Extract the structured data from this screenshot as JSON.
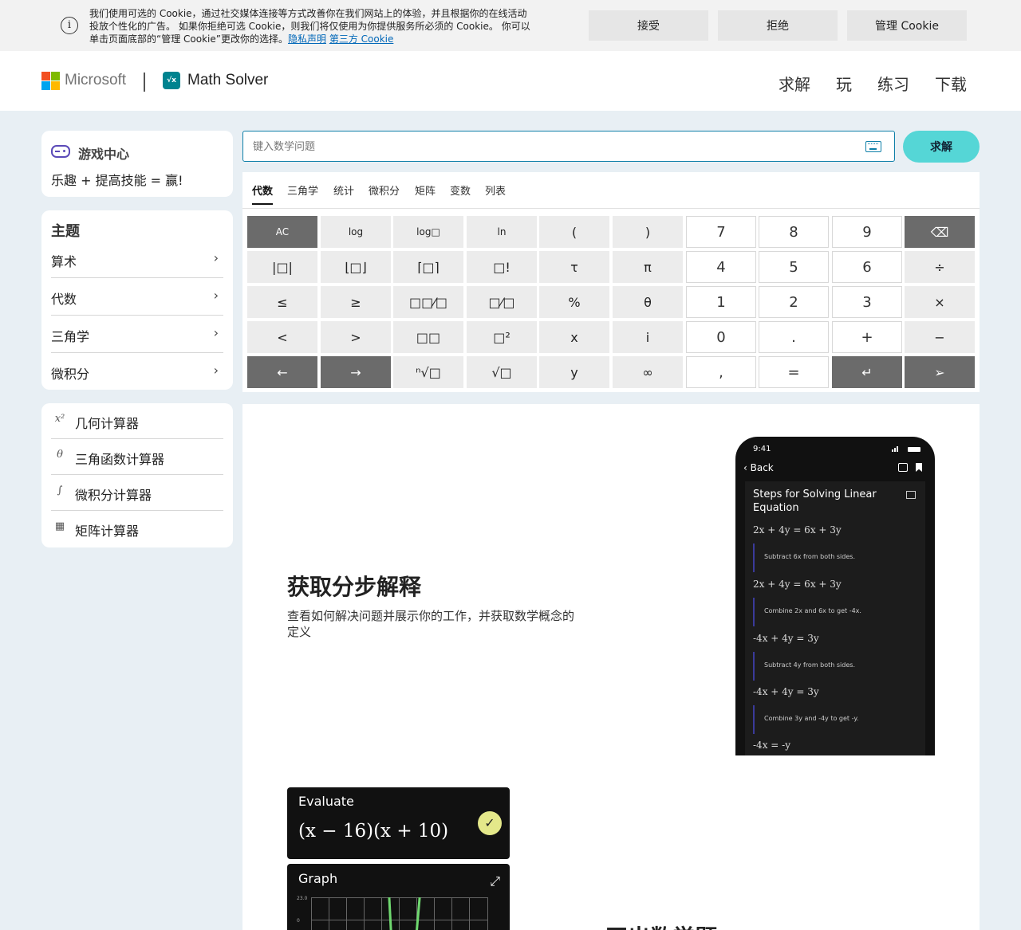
{
  "cookie": {
    "text": "我们使用可选的 Cookie，通过社交媒体连接等方式改善你在我们网站上的体验，并且根据你的在线活动投放个性化的广告。 如果你拒绝可选 Cookie，则我们将仅使用为你提供服务所必须的 Cookie。 你可以单击页面底部的“管理 Cookie”更改你的选择。",
    "privacy_link": "隐私声明",
    "third_party_link": "第三方 Cookie",
    "accept": "接受",
    "reject": "拒绝",
    "manage": "管理 Cookie"
  },
  "header": {
    "brand": "Microsoft",
    "app_name": "Math Solver",
    "app_icon_text": "√x",
    "nav": [
      "求解",
      "玩",
      "练习",
      "下载"
    ]
  },
  "sidebar": {
    "game": {
      "title": "游戏中心",
      "subtitle": "乐趣 + 提高技能 = 赢!"
    },
    "topics": {
      "title": "主题",
      "items": [
        "算术",
        "代数",
        "三角学",
        "微积分"
      ]
    },
    "calculators": [
      {
        "icon": "x²",
        "label": "几何计算器"
      },
      {
        "icon": "θ",
        "label": "三角函数计算器"
      },
      {
        "icon": "∫",
        "label": "微积分计算器"
      },
      {
        "icon": "▦",
        "label": "矩阵计算器"
      }
    ]
  },
  "search": {
    "placeholder": "键入数学问题",
    "solve": "求解"
  },
  "keypad": {
    "tabs": [
      "代数",
      "三角学",
      "统计",
      "微积分",
      "矩阵",
      "变数",
      "列表"
    ],
    "rows": [
      [
        "AC",
        "log",
        "log□",
        "ln",
        "(",
        ")",
        "7",
        "8",
        "9",
        "⌫"
      ],
      [
        "|□|",
        "⌊□⌋",
        "⌈□⌉",
        "□!",
        "τ",
        "π",
        "4",
        "5",
        "6",
        "÷"
      ],
      [
        "≤",
        "≥",
        "□□⁄□",
        "□⁄□",
        "%",
        "θ",
        "1",
        "2",
        "3",
        "×"
      ],
      [
        "<",
        ">",
        "□□",
        "□²",
        "x",
        "i",
        "0",
        ".",
        "+",
        "−"
      ],
      [
        "←",
        "→",
        "ⁿ√□",
        "√□",
        "y",
        "∞",
        ",",
        "=",
        "↵",
        "➢"
      ]
    ]
  },
  "feature": {
    "title": "获取分步解释",
    "description": "查看如何解决问题并展示你的工作，并获取数学概念的定义",
    "title2": "画出数学题"
  },
  "phone": {
    "time": "9:41",
    "back": "Back",
    "title": "Steps for Solving Linear Equation",
    "equations": [
      "2x + 4y = 6x + 3y",
      "2x + 4y = 6x + 3y",
      "-4x + 4y = 3y",
      "-4x + 4y = 3y",
      "-4x = -y"
    ],
    "steps": [
      "Subtract 6x from both sides.",
      "Combine 2x and 6x to get -4x.",
      "Subtract 4y from both sides.",
      "Combine 3y and -4y to get -y."
    ]
  },
  "evaluate": {
    "title": "Evaluate",
    "expression": "(x − 16)(x + 10)"
  },
  "graph": {
    "title": "Graph",
    "y_labels": [
      "23.0",
      "0"
    ]
  }
}
